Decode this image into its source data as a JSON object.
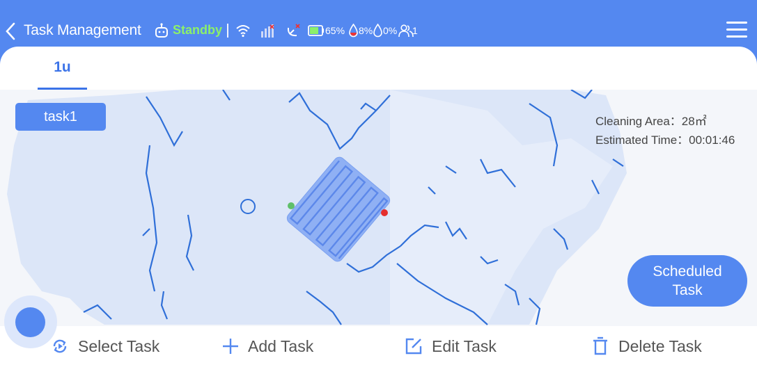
{
  "header": {
    "title": "Task Management",
    "status": "Standby",
    "battery": "65%",
    "water_level_1": "8%",
    "water_level_2": "0%",
    "people_count": "1",
    "status_color": "#8cf06a",
    "accent_color": "#5488f0"
  },
  "icons": [
    "back-icon",
    "robot-icon",
    "wifi-icon",
    "signal-icon",
    "satellite-icon",
    "battery-icon",
    "water-drop-icon",
    "water-drop-empty-icon",
    "people-icon",
    "menu-icon",
    "cycle-icon",
    "plus-icon",
    "edit-icon",
    "trash-icon"
  ],
  "tabs": [
    {
      "label": "1u",
      "active": true
    }
  ],
  "task_chip": {
    "label": "task1"
  },
  "map_info": {
    "cleaning_area": "Cleaning Area：28㎡",
    "estimated_time": "Estimated Time：00:01:46"
  },
  "scheduled_task": {
    "line1": "Scheduled",
    "line2": "Task"
  },
  "bottom_bar": {
    "select_task": "Select Task",
    "add_task": "Add Task",
    "edit_task": "Edit Task",
    "delete_task": "Delete Task"
  }
}
